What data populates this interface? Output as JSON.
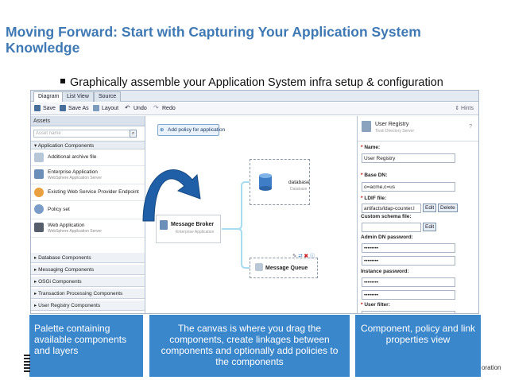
{
  "slide": {
    "title": "Moving Forward: Start with Capturing Your Application System Knowledge",
    "bullet": "Graphically assemble your Application System infra setup & configuration"
  },
  "app": {
    "tabs": [
      "Diagram",
      "List View",
      "Source"
    ],
    "toolbar": {
      "save": "Save",
      "save_as": "Save As",
      "layout": "Layout",
      "undo": "Undo",
      "redo": "Redo",
      "hints": "Hints"
    },
    "palette": {
      "header": "Assets",
      "search_placeholder": "Asset name",
      "group": "Application Components",
      "items": [
        {
          "name": "Additional archive file",
          "sub": ""
        },
        {
          "name": "Enterprise Application",
          "sub": "WebSphere Application Server"
        },
        {
          "name": "Existing Web Service Provider Endpoint",
          "sub": ""
        },
        {
          "name": "Policy set",
          "sub": ""
        },
        {
          "name": "Web Application",
          "sub": "WebSphere Application Server"
        }
      ],
      "categories": [
        "Database Components",
        "Messaging Components",
        "OSGi Components",
        "Transaction Processing Components",
        "User Registry Components"
      ]
    },
    "canvas": {
      "add_policy": "Add policy for application",
      "broker": {
        "title": "Message Broker",
        "sub": "Enterprise Application"
      },
      "database": {
        "title": "database",
        "sub": "Database"
      },
      "queue": {
        "title": "Message Queue"
      }
    },
    "properties": {
      "title": "User Registry",
      "subtitle": "Tivoli Directory Server",
      "help": "?",
      "fields": {
        "name_label": "Name:",
        "name_value": "User Registry",
        "base_dn_label": "Base DN:",
        "base_dn_value": "o=acme,c=us",
        "ldif_label": "LDIF file:",
        "ldif_value": "artifacts/ldap-counter.l",
        "edit": "Edit",
        "delete": "Delete",
        "schema_label": "Custom schema file:",
        "admin_pw_label": "Admin DN password:",
        "admin_pw_value": "••••••••",
        "admin_pw_confirm": "••••••••",
        "instance_pw_label": "Instance password:",
        "instance_pw_value": "••••••••",
        "instance_pw_confirm": "••••••••",
        "user_filter_label": "User filter:"
      }
    }
  },
  "callouts": {
    "left": "Palette containing available components and layers",
    "middle": "The canvas is where you drag the components, create linkages between components and optionally add policies to the components",
    "right": "Component, policy and link properties view"
  },
  "footer": {
    "corner": "oration"
  },
  "colors": {
    "title": "#3f79b4",
    "callout": "#3b87cc",
    "arrow": "#1f5fa8"
  }
}
